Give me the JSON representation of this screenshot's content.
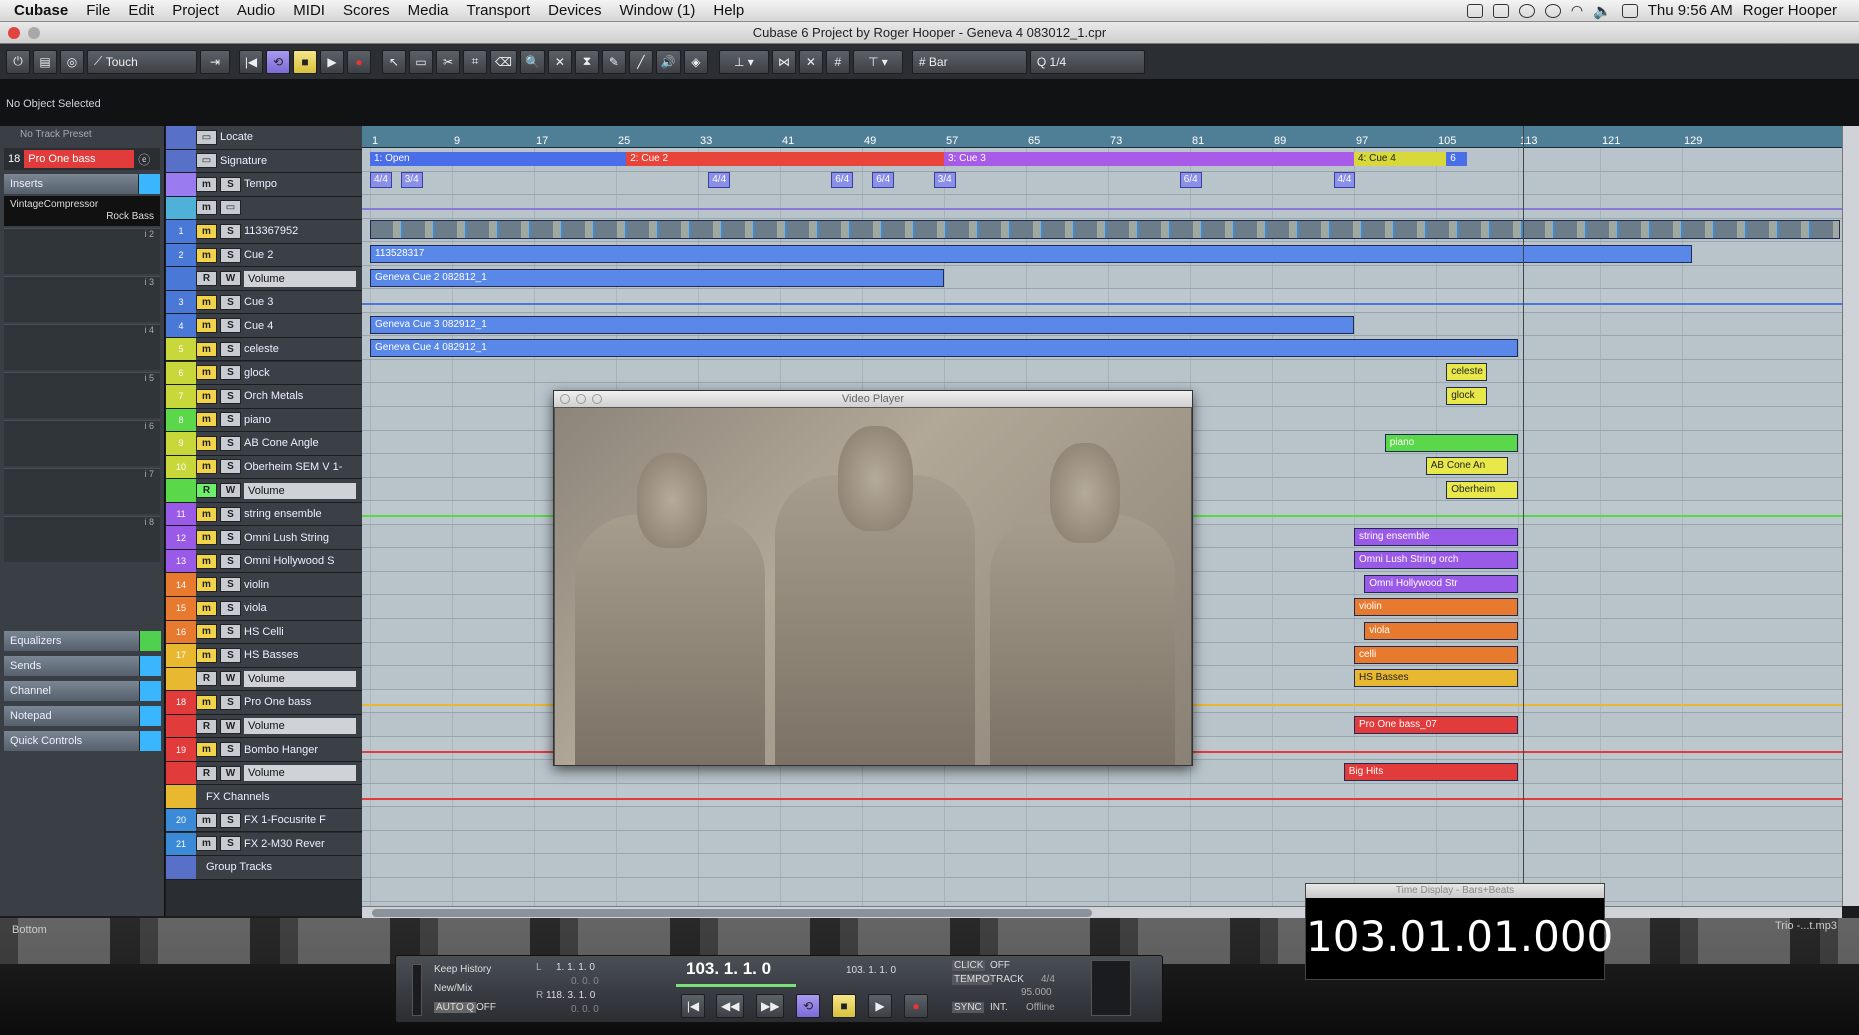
{
  "menubar": {
    "app": "Cubase",
    "items": [
      "File",
      "Edit",
      "Project",
      "Audio",
      "MIDI",
      "Scores",
      "Media",
      "Transport",
      "Devices",
      "Window (1)",
      "Help"
    ],
    "clock": "Thu 9:56 AM",
    "user": "Roger Hooper"
  },
  "window": {
    "title": "Cubase 6 Project by Roger Hooper - Geneva 4 083012_1.cpr"
  },
  "toolbar": {
    "automation_mode": "Touch",
    "snap_type": "Bar",
    "quantize": "1/4"
  },
  "infoline": {
    "text": "No Object Selected"
  },
  "inspector": {
    "preset": "No Track Preset",
    "track_number": "18",
    "track_name": "Pro One bass",
    "inserts_label": "Inserts",
    "plugin_name": "VintageCompressor",
    "plugin_preset": "Rock Bass",
    "slots": [
      "i 1",
      "i 2",
      "i 3",
      "i 4",
      "i 5",
      "i 6",
      "i 7",
      "i 8"
    ],
    "sections": [
      "Equalizers",
      "Sends",
      "Channel",
      "Notepad",
      "Quick Controls"
    ]
  },
  "tracks": [
    {
      "num": "",
      "label": "Locate",
      "kind": "marker",
      "color": "#5870c8"
    },
    {
      "num": "",
      "label": "Signature",
      "kind": "sig",
      "color": "#5870c8"
    },
    {
      "num": "",
      "label": "Tempo",
      "kind": "tempo",
      "color": "#9a7cf0"
    },
    {
      "num": "",
      "label": "",
      "kind": "video",
      "color": "#4fb0d8"
    },
    {
      "num": "1",
      "label": "113367952",
      "kind": "audio",
      "color": "#4a78d6"
    },
    {
      "num": "2",
      "label": "Cue 2",
      "kind": "audio",
      "color": "#4a78d6"
    },
    {
      "num": "",
      "label": "Volume",
      "kind": "sub",
      "color": "#4a78d6"
    },
    {
      "num": "3",
      "label": "Cue 3",
      "kind": "audio",
      "color": "#4a78d6"
    },
    {
      "num": "4",
      "label": "Cue 4",
      "kind": "audio",
      "color": "#4a78d6"
    },
    {
      "num": "5",
      "label": "celeste",
      "kind": "inst",
      "color": "#c8d83a"
    },
    {
      "num": "6",
      "label": "glock",
      "kind": "inst",
      "color": "#c8d83a"
    },
    {
      "num": "7",
      "label": "Orch Metals",
      "kind": "inst",
      "color": "#c8d83a"
    },
    {
      "num": "8",
      "label": "piano",
      "kind": "inst",
      "color": "#5ad84a"
    },
    {
      "num": "9",
      "label": "AB Cone Angle",
      "kind": "inst",
      "color": "#c8d83a"
    },
    {
      "num": "10",
      "label": "Oberheim SEM V 1-",
      "kind": "inst",
      "color": "#c8d83a"
    },
    {
      "num": "",
      "label": "Volume",
      "kind": "sub",
      "color": "#5ad84a"
    },
    {
      "num": "11",
      "label": "string ensemble",
      "kind": "inst",
      "color": "#9a5ae8"
    },
    {
      "num": "12",
      "label": "Omni Lush String",
      "kind": "inst",
      "color": "#9a5ae8"
    },
    {
      "num": "13",
      "label": "Omni Hollywood S",
      "kind": "inst",
      "color": "#9a5ae8"
    },
    {
      "num": "14",
      "label": "violin",
      "kind": "inst",
      "color": "#e87a30"
    },
    {
      "num": "15",
      "label": "viola",
      "kind": "inst",
      "color": "#e87a30"
    },
    {
      "num": "16",
      "label": "HS Celli",
      "kind": "inst",
      "color": "#e87a30"
    },
    {
      "num": "17",
      "label": "HS Basses",
      "kind": "inst",
      "color": "#e8b830"
    },
    {
      "num": "",
      "label": "Volume",
      "kind": "sub",
      "color": "#e8b830"
    },
    {
      "num": "18",
      "label": "Pro One bass",
      "kind": "inst",
      "color": "#e23b3b"
    },
    {
      "num": "",
      "label": "Volume",
      "kind": "sub",
      "color": "#e23b3b"
    },
    {
      "num": "19",
      "label": "Bombo Hanger",
      "kind": "inst",
      "color": "#e23b3b"
    },
    {
      "num": "",
      "label": "Volume",
      "kind": "sub",
      "color": "#e23b3b"
    },
    {
      "num": "",
      "label": "FX Channels",
      "kind": "folder",
      "color": "#e8b830"
    },
    {
      "num": "20",
      "label": "FX 1-Focusrite F",
      "kind": "fx",
      "color": "#3a8ad8"
    },
    {
      "num": "21",
      "label": "FX 2-M30 Rever",
      "kind": "fx",
      "color": "#3a8ad8"
    },
    {
      "num": "",
      "label": "Group Tracks",
      "kind": "folder",
      "color": "#5870c8"
    }
  ],
  "ruler_ticks": [
    "1",
    "9",
    "17",
    "25",
    "33",
    "41",
    "49",
    "57",
    "65",
    "73",
    "81",
    "89",
    "97",
    "105",
    "113",
    "121",
    "129"
  ],
  "markers": [
    {
      "label": "1: Open",
      "color": "#4a6ee8"
    },
    {
      "label": "2: Cue 2",
      "color": "#e8443a"
    },
    {
      "label": "3: Cue 3",
      "color": "#a85ae8"
    },
    {
      "label": "4: Cue 4",
      "color": "#d8d83a"
    },
    {
      "label": "6",
      "color": "#4a6ee8"
    }
  ],
  "signatures": [
    "4/4",
    "3/4",
    "4/4",
    "6/4",
    "6/4",
    "3/4",
    "6/4",
    "4/4"
  ],
  "parts": [
    {
      "label": "113528317",
      "lane": 4,
      "color": "#5a88e8"
    },
    {
      "label": "Geneva Cue 2 082812_1",
      "lane": 5,
      "color": "#5a88e8"
    },
    {
      "label": "Geneva Cue 3 082912_1",
      "lane": 7,
      "color": "#5a88e8"
    },
    {
      "label": "Geneva Cue 4 082912_1",
      "lane": 8,
      "color": "#5a88e8"
    },
    {
      "label": "celeste",
      "lane": 9,
      "color": "#e8e84a"
    },
    {
      "label": "glock",
      "lane": 10,
      "color": "#e8e84a"
    },
    {
      "label": "piano",
      "lane": 12,
      "color": "#5ad84a"
    },
    {
      "label": "AB Cone An",
      "lane": 13,
      "color": "#e8e84a"
    },
    {
      "label": "Oberheim",
      "lane": 14,
      "color": "#e8e84a"
    },
    {
      "label": "string ensemble",
      "lane": 16,
      "color": "#9a5ae8"
    },
    {
      "label": "Omni Lush String orch",
      "lane": 17,
      "color": "#9a5ae8"
    },
    {
      "label": "Omni Hollywood Str",
      "lane": 18,
      "color": "#9a5ae8"
    },
    {
      "label": "violin",
      "lane": 19,
      "color": "#e87a30"
    },
    {
      "label": "viola",
      "lane": 20,
      "color": "#e87a30"
    },
    {
      "label": "celli",
      "lane": 21,
      "color": "#e87a30"
    },
    {
      "label": "HS Basses",
      "lane": 22,
      "color": "#e8b830"
    },
    {
      "label": "Pro One bass_07",
      "lane": 24,
      "color": "#e23b3b"
    },
    {
      "label": "Big Hits",
      "lane": 26,
      "color": "#e23b3b"
    }
  ],
  "video_player": {
    "title": "Video Player"
  },
  "bottom": {
    "left_label": "Bottom",
    "right_label": "Trio -...t.mp3"
  },
  "transport": {
    "keep_history": "Keep History",
    "new_mix": "New/Mix",
    "auto_q": "AUTO Q",
    "auto_q_val": "OFF",
    "left_locator": "1. 1. 1. 0",
    "left_locator2": "0. 0. 0",
    "right_locator": "118. 3. 1. 0",
    "right_locator2": "0. 0. 0",
    "position_primary": "103. 1. 1. 0",
    "position_secondary": "103. 1. 1. 0",
    "click": "CLICK",
    "click_val": "OFF",
    "tempo": "TEMPO",
    "tempo_mode": "TRACK",
    "tempo_sig": "4/4",
    "tempo_val": "95.000",
    "sync": "SYNC",
    "sync_mode": "INT.",
    "sync_val": "Offline"
  },
  "time_display": {
    "title": "Time Display - Bars+Beats",
    "value": "103.01.01.000"
  }
}
